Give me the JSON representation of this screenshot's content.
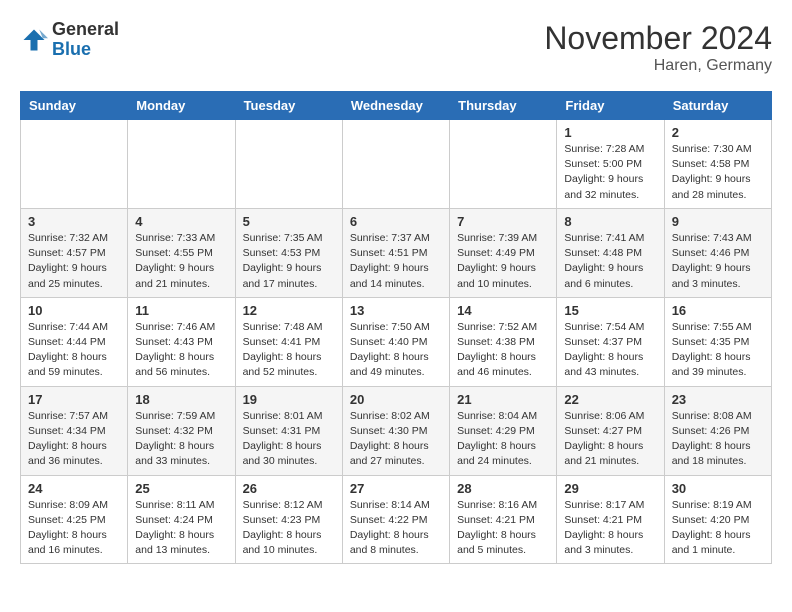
{
  "header": {
    "logo_line1": "General",
    "logo_line2": "Blue",
    "month_title": "November 2024",
    "location": "Haren, Germany"
  },
  "days_of_week": [
    "Sunday",
    "Monday",
    "Tuesday",
    "Wednesday",
    "Thursday",
    "Friday",
    "Saturday"
  ],
  "weeks": [
    [
      {
        "day": null,
        "info": null
      },
      {
        "day": null,
        "info": null
      },
      {
        "day": null,
        "info": null
      },
      {
        "day": null,
        "info": null
      },
      {
        "day": null,
        "info": null
      },
      {
        "day": "1",
        "info": "Sunrise: 7:28 AM\nSunset: 5:00 PM\nDaylight: 9 hours\nand 32 minutes."
      },
      {
        "day": "2",
        "info": "Sunrise: 7:30 AM\nSunset: 4:58 PM\nDaylight: 9 hours\nand 28 minutes."
      }
    ],
    [
      {
        "day": "3",
        "info": "Sunrise: 7:32 AM\nSunset: 4:57 PM\nDaylight: 9 hours\nand 25 minutes."
      },
      {
        "day": "4",
        "info": "Sunrise: 7:33 AM\nSunset: 4:55 PM\nDaylight: 9 hours\nand 21 minutes."
      },
      {
        "day": "5",
        "info": "Sunrise: 7:35 AM\nSunset: 4:53 PM\nDaylight: 9 hours\nand 17 minutes."
      },
      {
        "day": "6",
        "info": "Sunrise: 7:37 AM\nSunset: 4:51 PM\nDaylight: 9 hours\nand 14 minutes."
      },
      {
        "day": "7",
        "info": "Sunrise: 7:39 AM\nSunset: 4:49 PM\nDaylight: 9 hours\nand 10 minutes."
      },
      {
        "day": "8",
        "info": "Sunrise: 7:41 AM\nSunset: 4:48 PM\nDaylight: 9 hours\nand 6 minutes."
      },
      {
        "day": "9",
        "info": "Sunrise: 7:43 AM\nSunset: 4:46 PM\nDaylight: 9 hours\nand 3 minutes."
      }
    ],
    [
      {
        "day": "10",
        "info": "Sunrise: 7:44 AM\nSunset: 4:44 PM\nDaylight: 8 hours\nand 59 minutes."
      },
      {
        "day": "11",
        "info": "Sunrise: 7:46 AM\nSunset: 4:43 PM\nDaylight: 8 hours\nand 56 minutes."
      },
      {
        "day": "12",
        "info": "Sunrise: 7:48 AM\nSunset: 4:41 PM\nDaylight: 8 hours\nand 52 minutes."
      },
      {
        "day": "13",
        "info": "Sunrise: 7:50 AM\nSunset: 4:40 PM\nDaylight: 8 hours\nand 49 minutes."
      },
      {
        "day": "14",
        "info": "Sunrise: 7:52 AM\nSunset: 4:38 PM\nDaylight: 8 hours\nand 46 minutes."
      },
      {
        "day": "15",
        "info": "Sunrise: 7:54 AM\nSunset: 4:37 PM\nDaylight: 8 hours\nand 43 minutes."
      },
      {
        "day": "16",
        "info": "Sunrise: 7:55 AM\nSunset: 4:35 PM\nDaylight: 8 hours\nand 39 minutes."
      }
    ],
    [
      {
        "day": "17",
        "info": "Sunrise: 7:57 AM\nSunset: 4:34 PM\nDaylight: 8 hours\nand 36 minutes."
      },
      {
        "day": "18",
        "info": "Sunrise: 7:59 AM\nSunset: 4:32 PM\nDaylight: 8 hours\nand 33 minutes."
      },
      {
        "day": "19",
        "info": "Sunrise: 8:01 AM\nSunset: 4:31 PM\nDaylight: 8 hours\nand 30 minutes."
      },
      {
        "day": "20",
        "info": "Sunrise: 8:02 AM\nSunset: 4:30 PM\nDaylight: 8 hours\nand 27 minutes."
      },
      {
        "day": "21",
        "info": "Sunrise: 8:04 AM\nSunset: 4:29 PM\nDaylight: 8 hours\nand 24 minutes."
      },
      {
        "day": "22",
        "info": "Sunrise: 8:06 AM\nSunset: 4:27 PM\nDaylight: 8 hours\nand 21 minutes."
      },
      {
        "day": "23",
        "info": "Sunrise: 8:08 AM\nSunset: 4:26 PM\nDaylight: 8 hours\nand 18 minutes."
      }
    ],
    [
      {
        "day": "24",
        "info": "Sunrise: 8:09 AM\nSunset: 4:25 PM\nDaylight: 8 hours\nand 16 minutes."
      },
      {
        "day": "25",
        "info": "Sunrise: 8:11 AM\nSunset: 4:24 PM\nDaylight: 8 hours\nand 13 minutes."
      },
      {
        "day": "26",
        "info": "Sunrise: 8:12 AM\nSunset: 4:23 PM\nDaylight: 8 hours\nand 10 minutes."
      },
      {
        "day": "27",
        "info": "Sunrise: 8:14 AM\nSunset: 4:22 PM\nDaylight: 8 hours\nand 8 minutes."
      },
      {
        "day": "28",
        "info": "Sunrise: 8:16 AM\nSunset: 4:21 PM\nDaylight: 8 hours\nand 5 minutes."
      },
      {
        "day": "29",
        "info": "Sunrise: 8:17 AM\nSunset: 4:21 PM\nDaylight: 8 hours\nand 3 minutes."
      },
      {
        "day": "30",
        "info": "Sunrise: 8:19 AM\nSunset: 4:20 PM\nDaylight: 8 hours\nand 1 minute."
      }
    ]
  ]
}
